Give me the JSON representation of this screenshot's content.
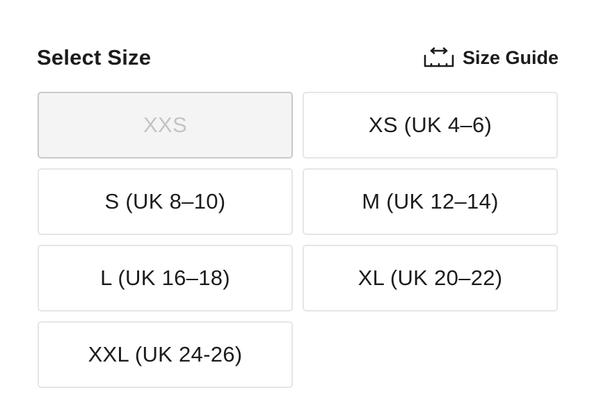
{
  "header": {
    "title": "Select Size",
    "guide_label": "Size Guide",
    "guide_icon": "ruler-width-icon"
  },
  "sizes": [
    {
      "label": "XXS",
      "available": false
    },
    {
      "label": "XS (UK 4–6)",
      "available": true
    },
    {
      "label": "S (UK 8–10)",
      "available": true
    },
    {
      "label": "M (UK 12–14)",
      "available": true
    },
    {
      "label": "L (UK 16–18)",
      "available": true
    },
    {
      "label": "XL (UK 20–22)",
      "available": true
    },
    {
      "label": "XXL (UK 24-26)",
      "available": true
    }
  ],
  "colors": {
    "text": "#1c1c1c",
    "border": "#e6e6e6",
    "disabled_bg": "#f4f4f4",
    "disabled_text": "#c4c4c4"
  }
}
